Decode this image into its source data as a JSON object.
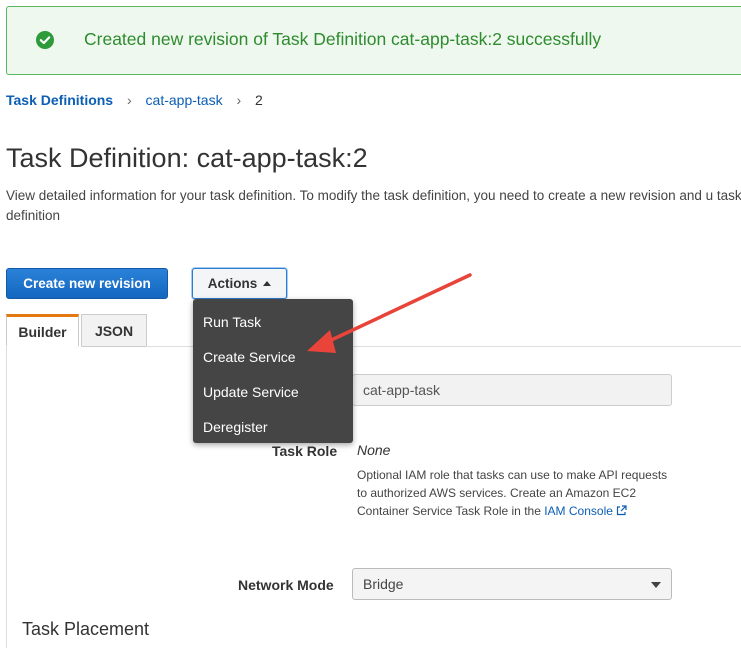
{
  "banner": {
    "message": "Created new revision of Task Definition cat-app-task:2 successfully",
    "icon": "check-circle-icon",
    "color": "#2e8b2e"
  },
  "breadcrumb": {
    "root": "Task Definitions",
    "family": "cat-app-task",
    "revision": "2",
    "separator": "›"
  },
  "page": {
    "title": "Task Definition: cat-app-task:2",
    "description": "View detailed information for your task definition. To modify the task definition, you need to create a new revision and u task definition"
  },
  "toolbar": {
    "create_revision_label": "Create new revision",
    "actions_label": "Actions"
  },
  "actions_menu": {
    "items": [
      "Run Task",
      "Create Service",
      "Update Service",
      "Deregister"
    ]
  },
  "tabs": {
    "builder": "Builder",
    "json": "JSON"
  },
  "form": {
    "family_value": "cat-app-task",
    "task_role_label": "Task Role",
    "task_role_value": "None",
    "task_role_help": "Optional IAM role that tasks can use to make API requests to authorized AWS services. Create an Amazon EC2 Container Service Task Role in the ",
    "task_role_link": "IAM Console",
    "network_mode_label": "Network Mode",
    "network_mode_value": "Bridge",
    "section_task_placement": "Task Placement"
  },
  "colors": {
    "primary": "#1466bf",
    "link": "#0b5eb4",
    "annotation_arrow": "#e8443a",
    "tab_accent": "#e47911"
  }
}
